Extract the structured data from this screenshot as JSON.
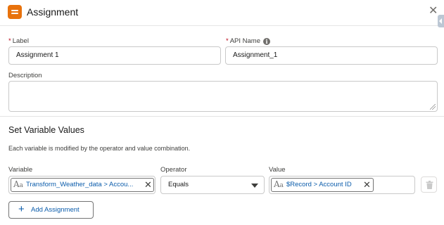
{
  "header": {
    "title": "Assignment",
    "close_icon": "close-icon"
  },
  "form": {
    "label_field": {
      "label": "Label",
      "required_marker": "*",
      "value": "Assignment 1"
    },
    "api_name_field": {
      "label": "API Name",
      "required_marker": "*",
      "value": "Assignment_1",
      "info_glyph": "i"
    },
    "description_field": {
      "label": "Description",
      "value": ""
    }
  },
  "section": {
    "title": "Set Variable Values",
    "description": "Each variable is modified by the operator and value combination."
  },
  "assignment_row": {
    "variable_label": "Variable",
    "operator_label": "Operator",
    "value_label": "Value",
    "variable_value": "Transform_Weather_data > Accou...",
    "operator_value": "Equals",
    "value_value": "$Record > Account ID",
    "pill_icon_text": "A",
    "pill_icon_sub": "a",
    "pill_remove": "✕"
  },
  "actions": {
    "add_assignment_label": "Add Assignment",
    "add_icon": "+"
  },
  "colors": {
    "accent": "#e8720c",
    "link": "#0b5cab",
    "required": "#ba0517",
    "border": "#c9c9c9"
  }
}
